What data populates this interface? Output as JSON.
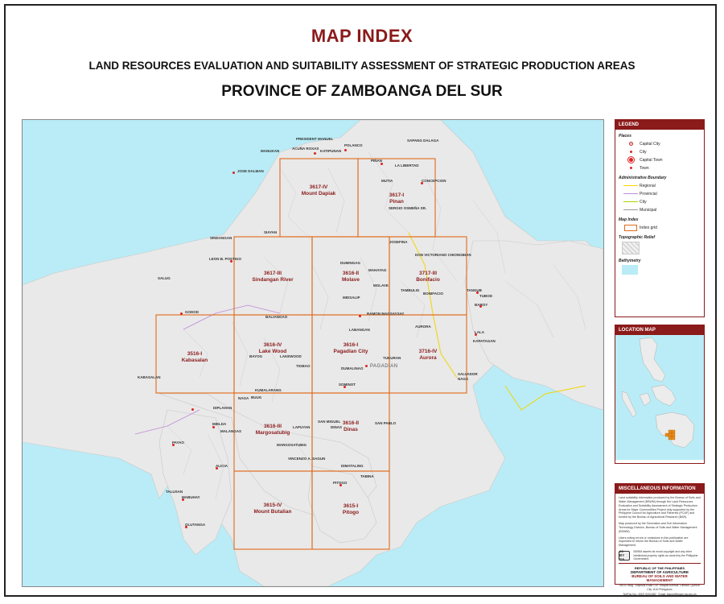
{
  "header": {
    "title": "MAP INDEX",
    "subtitle": "LAND RESOURCES EVALUATION AND SUITABILITY ASSESSMENT OF STRATEGIC PRODUCTION AREAS",
    "province": "PROVINCE OF ZAMBOANGA DEL SUR"
  },
  "map": {
    "water_color": "#b9ecf6",
    "land_color": "#e9e9e9",
    "grid_color": "#e06a1a",
    "tiles": [
      {
        "num": "3617-IV",
        "name": "Mount Dapiak"
      },
      {
        "num": "3617-I",
        "name": "Pinan"
      },
      {
        "num": "3617-III",
        "name": "Sindangan River"
      },
      {
        "num": "3616-II",
        "name": "Molave"
      },
      {
        "num": "3717-III",
        "name": "Bonifacio"
      },
      {
        "num": "3516-I",
        "name": "Kabasalan"
      },
      {
        "num": "3616-IV",
        "name": "Lake Wood"
      },
      {
        "num": "3616-I",
        "name": "Pagadian City"
      },
      {
        "num": "3716-IV",
        "name": "Aurora"
      },
      {
        "num": "3616-III",
        "name": "Margosatubig"
      },
      {
        "num": "3616-II",
        "name": "Dinas"
      },
      {
        "num": "3615-IV",
        "name": "Mount Butalian"
      },
      {
        "num": "3615-I",
        "name": "Pitogo"
      }
    ],
    "city_label": "PAGADIAN",
    "places": [
      "PRESIDENT MANUEL",
      "ACUÑA ROXAS",
      "POLANCO",
      "SAPANG DALAGA",
      "KATIPUNAN",
      "MANUKAN",
      "JOSE DALMAN",
      "PIÑAN",
      "LA LIBERTAD",
      "MUTIA",
      "CONCEPCION",
      "SERGIO OSMEÑA SR.",
      "SIAYAN",
      "SINDANGAN",
      "LEON B. POSTIGO",
      "JOSEFINA",
      "DON VICTORIANO CHIONGBIAN",
      "DUMINGAG",
      "MAHAYAG",
      "SALUG",
      "MOLAVE",
      "TAMBULIG",
      "BONIFACIO",
      "MIDSALIP",
      "TANGUB",
      "TUBOD",
      "BAROY",
      "GODOD",
      "RAMON MAGSAYSAY",
      "BALIANGAO",
      "AURORA",
      "LABANGAN",
      "LALA",
      "KAPATAGAN",
      "BAYOG",
      "LAKEWOOD",
      "TIGBAO",
      "TUKURAN",
      "DUMALINAO",
      "SALVADOR",
      "NAGA",
      "KABASALAN",
      "KUMALARANG",
      "SOMINOT",
      "BUUG",
      "DIPLAHAN",
      "IMELDA",
      "MALANGAS",
      "SAN MIGUEL",
      "DINAS",
      "SAN PABLO",
      "LAPUYAN",
      "PAYAO",
      "MARGOSATUBIG",
      "ALICIA",
      "VINCENZO A. SAGUN",
      "DIMATALING",
      "TABINA",
      "PITOGO",
      "TALUSAN",
      "MABUHAY",
      "OLUTANGA",
      "NAGA"
    ]
  },
  "legend": {
    "title": "LEGEND",
    "places_title": "Places",
    "places": [
      {
        "label": "Capital City",
        "symbol": "capital-city"
      },
      {
        "label": "City",
        "symbol": "city"
      },
      {
        "label": "Capital Town",
        "symbol": "capital-town"
      },
      {
        "label": "Town",
        "symbol": "town"
      }
    ],
    "admin_title": "Administrative Boundary",
    "admin": [
      {
        "label": "Regional",
        "color": "#f2d600"
      },
      {
        "label": "Provincial",
        "color": "#c08ad8"
      },
      {
        "label": "City",
        "color": "#a6d800"
      },
      {
        "label": "Municipal",
        "color": "#9a9a9a"
      }
    ],
    "index_title": "Map Index",
    "index_label": "Index grid",
    "relief_title": "Topographic Relief",
    "bathy_title": "Bathymetry"
  },
  "location_map": {
    "title": "LOCATION MAP",
    "water_color": "#b9ecf6"
  },
  "misc": {
    "title": "MISCELLANEOUS INFORMATION",
    "p1": "Land suitability information produced by the Bureau of Soils and Water Management (BSWM) through the Land Resources Evaluation and Suitability Assessment of Strategic Production Areas for Major Commodities Project duly supported by the Philippine Council for Agriculture and Fisheries (PCAF) and funded by the Bureau of Agricultural Research (BAR).",
    "p2": "Map produced by the Geomatics and Soil Information Technology Division, Bureau of Soils and Water Management (BSWM).",
    "p3": "Users noting errors or omissions in this publication are requested to inform the Bureau of Soils and Water Management.",
    "cc_badge": "cc BY SA",
    "cc_text": "BSWM asserts its moral copyright and any other intellectual property rights as owned by the Philippine Government.",
    "org1": "REPUBLIC OF THE PHILIPPINES",
    "org2": "DEPARTMENT OF AGRICULTURE",
    "org3": "BUREAU OF SOILS AND WATER MANAGEMENT",
    "address": "SRDC Bldg., Elliptical Road Cor. Visayas Avenue, Diliman, Quezon City 1100 Philippines",
    "contact": "Tel/Fax No.: (632) 9204382 · Email: bswm@bswm.da.gov.ph"
  }
}
